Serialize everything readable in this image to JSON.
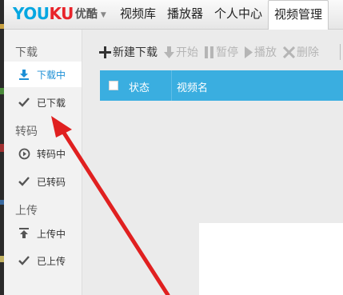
{
  "header": {
    "logo_text_a": "YOU",
    "logo_text_b": "KU",
    "logo_cn": "优酷",
    "nav": [
      {
        "label": "视频库"
      },
      {
        "label": "播放器"
      },
      {
        "label": "个人中心"
      },
      {
        "label": "视频管理",
        "active": true
      }
    ]
  },
  "sidebar": {
    "download_title": "下载",
    "downloading": "下载中",
    "downloaded": "已下载",
    "transcode_title": "转码",
    "transcoding": "转码中",
    "transcoded": "已转码",
    "upload_title": "上传",
    "uploading": "上传中",
    "uploaded": "已上传"
  },
  "toolbar": {
    "new_download": "新建下载",
    "start": "开始",
    "pause": "暂停",
    "play": "播放",
    "delete": "删除"
  },
  "table": {
    "col_status": "状态",
    "col_name": "视频名"
  },
  "colors": {
    "accent": "#3aaee0",
    "active_text": "#1c8fd6",
    "arrow": "#e02020"
  }
}
